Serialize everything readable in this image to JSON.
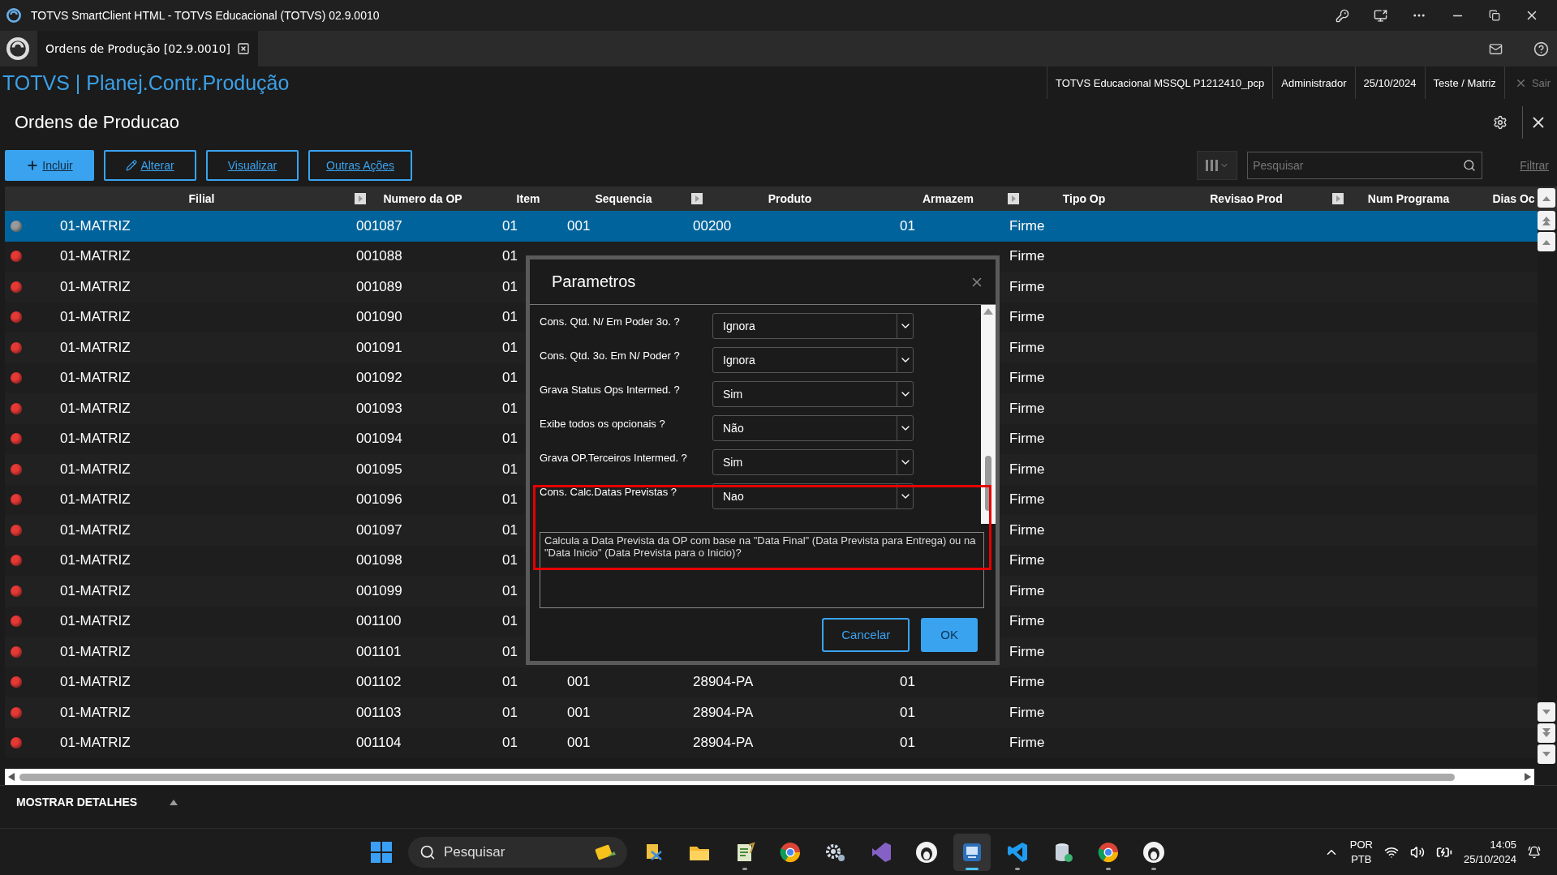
{
  "window": {
    "title": "TOTVS SmartClient HTML - TOTVS Educacional (TOTVS) 02.9.0010"
  },
  "tab": {
    "label": "Ordens de Produção [02.9.0010]",
    "selected": true
  },
  "app_header": {
    "title": "TOTVS | Planej.Contr.Produção",
    "info": [
      "TOTVS Educacional MSSQL P1212410_pcp",
      "Administrador",
      "25/10/2024",
      "Teste / Matriz"
    ],
    "logout": "Sair"
  },
  "page": {
    "title": "Ordens de Producao"
  },
  "toolbar": {
    "buttons": [
      {
        "label": "Incluir",
        "kind": "primary"
      },
      {
        "label": "Alterar",
        "kind": "edit"
      },
      {
        "label": "Visualizar",
        "kind": "plain"
      },
      {
        "label": "Outras Ações",
        "kind": "plain"
      }
    ],
    "search": {
      "placeholder": "Pesquisar"
    },
    "filter_link": "Filtrar"
  },
  "table": {
    "columns": [
      {
        "label": "Filial",
        "marker": false
      },
      {
        "label": "Numero da OP",
        "marker": true
      },
      {
        "label": "Item",
        "marker": false
      },
      {
        "label": "Sequencia",
        "marker": false
      },
      {
        "label": "Produto",
        "marker": true
      },
      {
        "label": "Armazem",
        "marker": false
      },
      {
        "label": "Tipo Op",
        "marker": true
      },
      {
        "label": "Revisao Prod",
        "marker": false
      },
      {
        "label": "Num Programa",
        "marker": true
      },
      {
        "label": "Dias Oc",
        "marker": false
      }
    ],
    "rows": [
      {
        "selected": true,
        "color": "#9a9a9a",
        "cells": [
          "01-MATRIZ",
          "001087",
          "01",
          "001",
          "00200",
          "01",
          "Firme"
        ]
      },
      {
        "selected": false,
        "color": "#e53935",
        "cells": [
          "01-MATRIZ",
          "001088",
          "01",
          null,
          null,
          null,
          "Firme"
        ]
      },
      {
        "selected": false,
        "color": "#e53935",
        "cells": [
          "01-MATRIZ",
          "001089",
          "01",
          null,
          null,
          null,
          "Firme"
        ]
      },
      {
        "selected": false,
        "color": "#e53935",
        "cells": [
          "01-MATRIZ",
          "001090",
          "01",
          null,
          null,
          null,
          "Firme"
        ]
      },
      {
        "selected": false,
        "color": "#e53935",
        "cells": [
          "01-MATRIZ",
          "001091",
          "01",
          null,
          null,
          null,
          "Firme"
        ]
      },
      {
        "selected": false,
        "color": "#e53935",
        "cells": [
          "01-MATRIZ",
          "001092",
          "01",
          null,
          null,
          null,
          "Firme"
        ]
      },
      {
        "selected": false,
        "color": "#e53935",
        "cells": [
          "01-MATRIZ",
          "001093",
          "01",
          null,
          null,
          null,
          "Firme"
        ]
      },
      {
        "selected": false,
        "color": "#e53935",
        "cells": [
          "01-MATRIZ",
          "001094",
          "01",
          null,
          null,
          null,
          "Firme"
        ]
      },
      {
        "selected": false,
        "color": "#e53935",
        "cells": [
          "01-MATRIZ",
          "001095",
          "01",
          null,
          null,
          null,
          "Firme"
        ]
      },
      {
        "selected": false,
        "color": "#e53935",
        "cells": [
          "01-MATRIZ",
          "001096",
          "01",
          null,
          null,
          null,
          "Firme"
        ]
      },
      {
        "selected": false,
        "color": "#e53935",
        "cells": [
          "01-MATRIZ",
          "001097",
          "01",
          null,
          null,
          null,
          "Firme"
        ]
      },
      {
        "selected": false,
        "color": "#e53935",
        "cells": [
          "01-MATRIZ",
          "001098",
          "01",
          null,
          null,
          null,
          "Firme"
        ]
      },
      {
        "selected": false,
        "color": "#e53935",
        "cells": [
          "01-MATRIZ",
          "001099",
          "01",
          null,
          null,
          null,
          "Firme"
        ]
      },
      {
        "selected": false,
        "color": "#e53935",
        "cells": [
          "01-MATRIZ",
          "001100",
          "01",
          null,
          null,
          null,
          "Firme"
        ]
      },
      {
        "selected": false,
        "color": "#e53935",
        "cells": [
          "01-MATRIZ",
          "001101",
          "01",
          null,
          null,
          null,
          "Firme"
        ]
      },
      {
        "selected": false,
        "color": "#e53935",
        "cells": [
          "01-MATRIZ",
          "001102",
          "01",
          "001",
          "28904-PA",
          "01",
          "Firme"
        ]
      },
      {
        "selected": false,
        "color": "#e53935",
        "cells": [
          "01-MATRIZ",
          "001103",
          "01",
          "001",
          "28904-PA",
          "01",
          "Firme"
        ]
      },
      {
        "selected": false,
        "color": "#e53935",
        "cells": [
          "01-MATRIZ",
          "001104",
          "01",
          "001",
          "28904-PA",
          "01",
          "Firme"
        ]
      }
    ]
  },
  "details_bar": {
    "label": "MOSTRAR DETALHES",
    "expanded": false
  },
  "dialog": {
    "title": "Parametros",
    "params": [
      {
        "label": "Cons. Qtd. N/ Em Poder 3o. ?",
        "value": "Ignora"
      },
      {
        "label": "Cons. Qtd. 3o. Em N/ Poder ?",
        "value": "Ignora"
      },
      {
        "label": "Grava Status Ops Intermed. ?",
        "value": "Sim"
      },
      {
        "label": "Exibe todos os opcionais ?",
        "value": "Não"
      },
      {
        "label": "Grava OP.Terceiros Intermed. ?",
        "value": "Sim"
      },
      {
        "label": "Cons. Calc.Datas Previstas ?",
        "value": "Nao"
      }
    ],
    "description": "Calcula a Data Prevista da OP com base na \"Data Final\" (Data Prevista para Entrega) ou na \"Data Inicio\" (Data Prevista para o Inicio)?",
    "buttons": [
      {
        "label": "Cancelar",
        "kind": "secondary"
      },
      {
        "label": "OK",
        "kind": "primary"
      }
    ]
  },
  "taskbar": {
    "search": {
      "placeholder": "Pesquisar"
    },
    "apps": [
      {
        "running": false,
        "active": false
      },
      {
        "running": false,
        "active": false
      },
      {
        "running": true,
        "active": false
      },
      {
        "running": false,
        "active": false
      },
      {
        "running": false,
        "active": false
      },
      {
        "running": false,
        "active": false
      },
      {
        "running": false,
        "active": false
      },
      {
        "running": true,
        "active": true
      },
      {
        "running": true,
        "active": false
      },
      {
        "running": false,
        "active": false
      },
      {
        "running": true,
        "active": false
      },
      {
        "running": true,
        "active": false
      }
    ],
    "language": [
      "POR",
      "PTB"
    ],
    "time": "14:05",
    "date": "25/10/2024"
  }
}
